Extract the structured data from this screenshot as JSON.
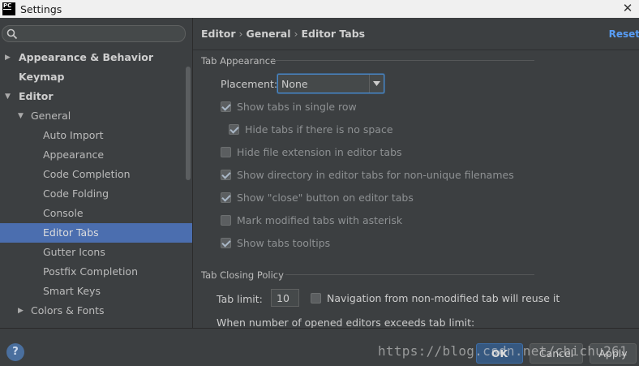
{
  "window": {
    "title": "Settings",
    "app_icon_text": "PC",
    "close_glyph": "✕"
  },
  "sidebar": {
    "search_placeholder": "",
    "items": [
      {
        "label": "Appearance & Behavior",
        "arrow": "▶"
      },
      {
        "label": "Keymap",
        "arrow": ""
      },
      {
        "label": "Editor",
        "arrow": "▼"
      },
      {
        "label": "General",
        "arrow": "▼"
      },
      {
        "label": "Auto Import"
      },
      {
        "label": "Appearance"
      },
      {
        "label": "Code Completion"
      },
      {
        "label": "Code Folding"
      },
      {
        "label": "Console"
      },
      {
        "label": "Editor Tabs"
      },
      {
        "label": "Gutter Icons"
      },
      {
        "label": "Postfix Completion"
      },
      {
        "label": "Smart Keys"
      },
      {
        "label": "Colors & Fonts",
        "arrow": "▶"
      }
    ],
    "selected_index": 9
  },
  "breadcrumb": {
    "part1": "Editor",
    "part2": "General",
    "part3": "Editor Tabs",
    "separator": "›"
  },
  "reset_label": "Reset",
  "tab_appearance": {
    "section_title": "Tab Appearance",
    "placement_label": "Placement:",
    "placement_value": "None",
    "options": [
      {
        "label": "Show tabs in single row",
        "checked": true
      },
      {
        "label": "Hide tabs if there is no space",
        "checked": true
      },
      {
        "label": "Hide file extension in editor tabs",
        "checked": false
      },
      {
        "label": "Show directory in editor tabs for non-unique filenames",
        "checked": true
      },
      {
        "label": "Show \"close\" button on editor tabs",
        "checked": true
      },
      {
        "label": "Mark modified tabs with asterisk",
        "checked": false
      },
      {
        "label": "Show tabs tooltips",
        "checked": true
      }
    ]
  },
  "tab_closing": {
    "section_title": "Tab Closing Policy",
    "tab_limit_label": "Tab limit:",
    "tab_limit_value": "10",
    "navigation_option": {
      "label": "Navigation from non-modified tab will reuse it",
      "checked": false
    },
    "when_label": "When number of opened editors exceeds tab limit:"
  },
  "buttons": {
    "help": "?",
    "ok": "OK",
    "cancel": "Cancel",
    "apply": "Apply"
  },
  "watermark": "https://blog.csdn.net/chichu261",
  "colors": {
    "background": "#3c3f41",
    "selection": "#4b6eaf",
    "link": "#589df6",
    "focus": "#4a88c7"
  }
}
